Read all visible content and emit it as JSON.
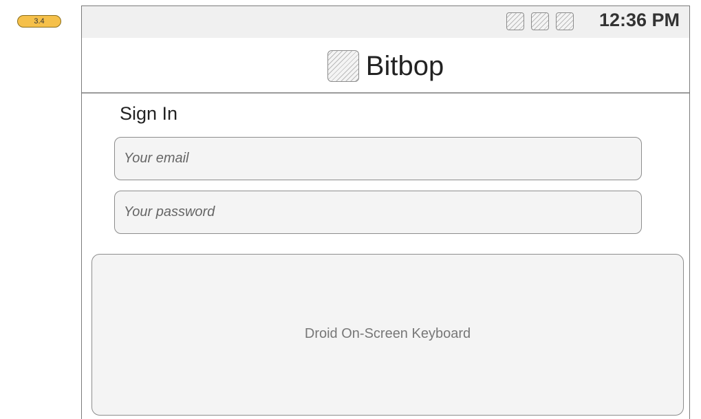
{
  "annotation": {
    "version_label": "3.4"
  },
  "status_bar": {
    "icons": [
      "signal-icon",
      "wifi-icon",
      "battery-icon"
    ],
    "time": "12:36 PM"
  },
  "header": {
    "logo_icon": "app-logo-icon",
    "title": "Bitbop"
  },
  "signin": {
    "title": "Sign In",
    "email_placeholder": "Your email",
    "password_placeholder": "Your password"
  },
  "keyboard": {
    "label": "Droid On-Screen Keyboard"
  },
  "colors": {
    "badge": "#f5c04a",
    "field_background": "#f4f4f4",
    "status_bar_background": "#f0f0f0",
    "border": "#8c8c8c"
  }
}
